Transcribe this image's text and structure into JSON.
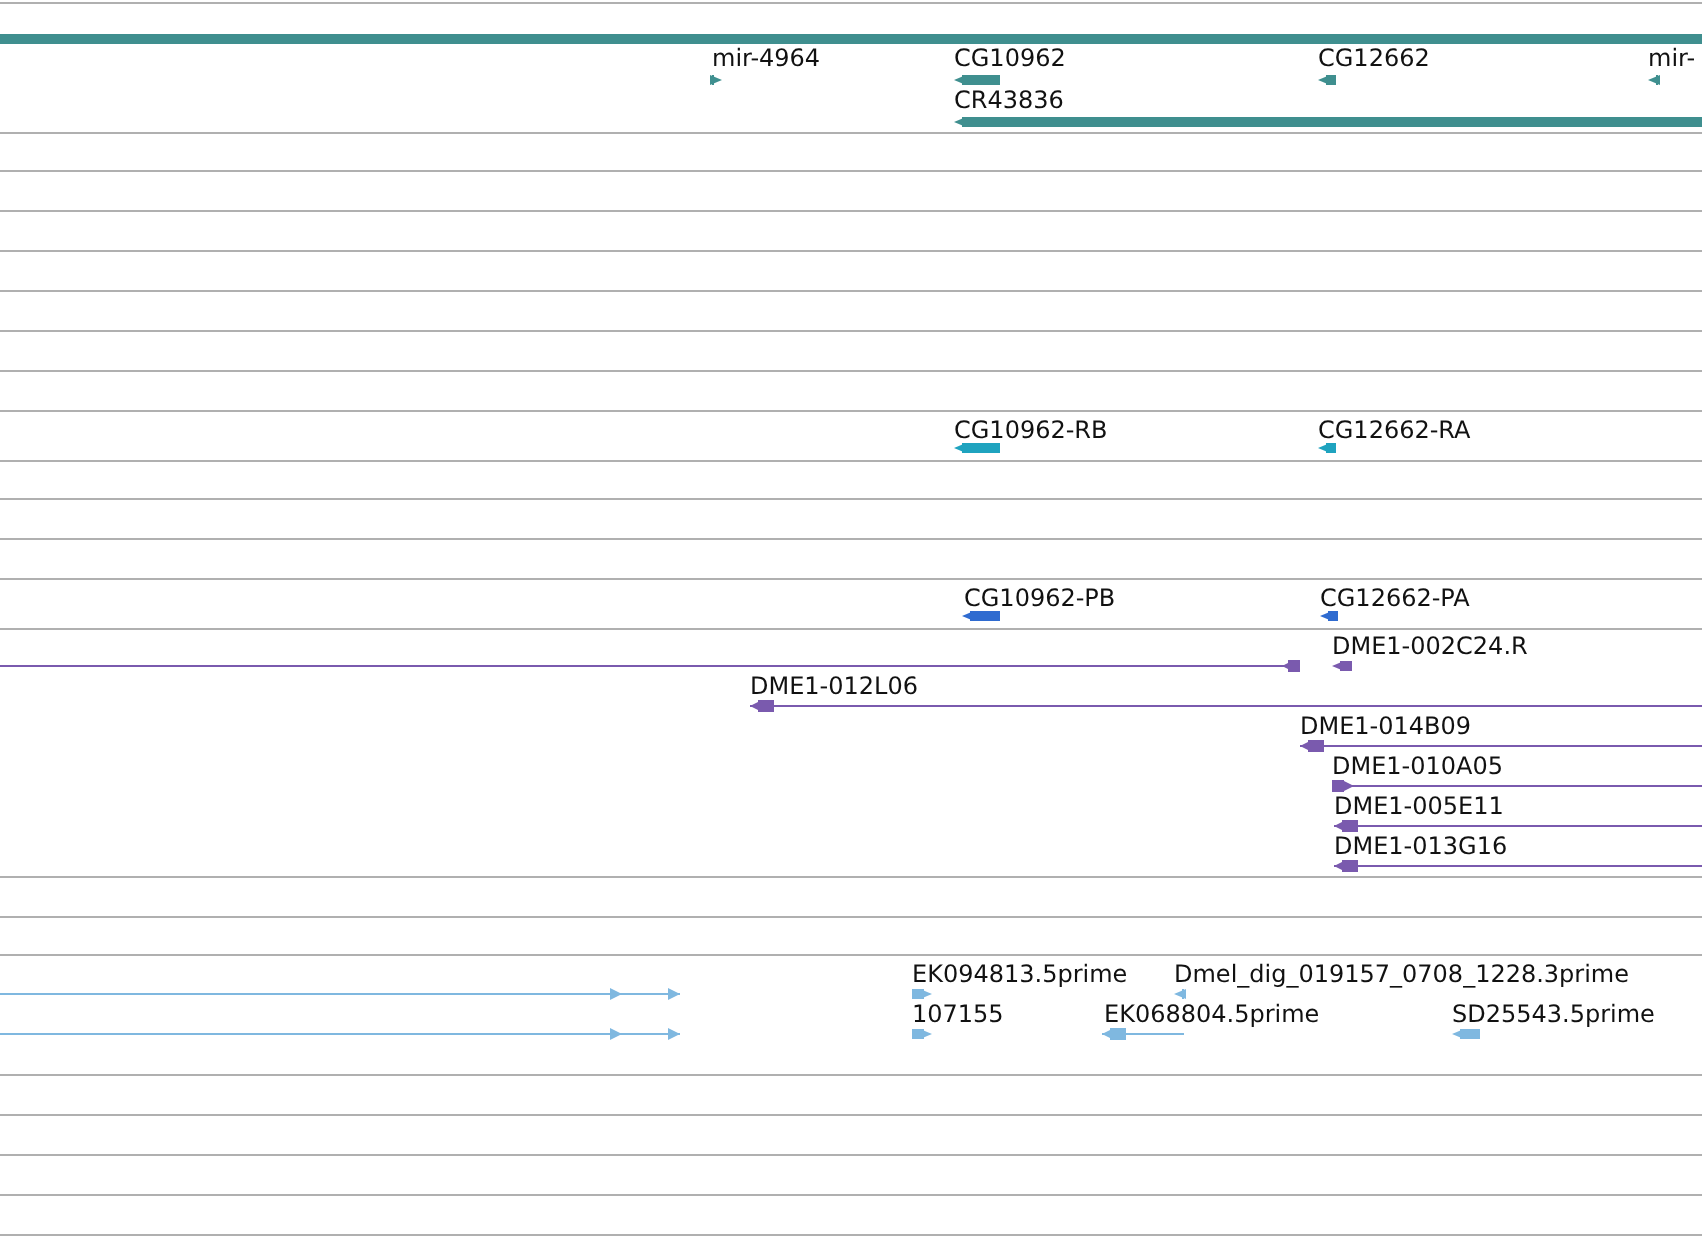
{
  "tracks": [
    {
      "color": "#3f8f8f",
      "features": [
        {
          "label": "mir-4964",
          "reverse": false
        },
        {
          "label": "CG10962",
          "reverse": true
        },
        {
          "label": "CG12662",
          "reverse": true
        },
        {
          "label": "mir-",
          "reverse": true
        },
        {
          "label": "CR43836",
          "reverse": true
        }
      ]
    },
    {
      "color": "#1fa3bf",
      "features": [
        {
          "label": "CG10962-RB",
          "reverse": true
        },
        {
          "label": "CG12662-RA",
          "reverse": true
        }
      ]
    },
    {
      "color": "#2f6bd0",
      "features": [
        {
          "label": "CG10962-PB",
          "reverse": true
        },
        {
          "label": "CG12662-PA",
          "reverse": true
        }
      ]
    },
    {
      "color": "#7a5aae",
      "features": [
        {
          "label": "DME1-002C24.R",
          "reverse": true
        },
        {
          "label": "DME1-012L06",
          "reverse": true
        },
        {
          "label": "DME1-014B09",
          "reverse": true
        },
        {
          "label": "DME1-010A05",
          "reverse": false
        },
        {
          "label": "DME1-005E11",
          "reverse": true
        },
        {
          "label": "DME1-013G16",
          "reverse": true
        }
      ]
    },
    {
      "color": "#7fb8e0",
      "features": [
        {
          "label": "EK094813.5prime",
          "reverse": false
        },
        {
          "label": "Dmel_dig_019157_0708_1228.3prime",
          "reverse": true
        },
        {
          "label": "107155",
          "reverse": false
        },
        {
          "label": "EK068804.5prime",
          "reverse": true
        },
        {
          "label": "SD25543.5prime",
          "reverse": true
        }
      ]
    }
  ]
}
